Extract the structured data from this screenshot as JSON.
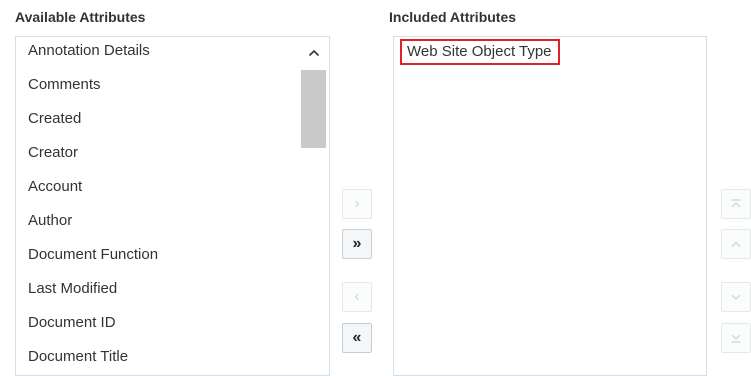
{
  "available": {
    "heading": "Available Attributes",
    "items": [
      "Annotation Details",
      "Comments",
      "Created",
      "Creator",
      "Account",
      "Author",
      "Document Function",
      "Last Modified",
      "Document ID",
      "Document Title"
    ]
  },
  "included": {
    "heading": "Included Attributes",
    "items": [
      "Web Site Object Type"
    ]
  },
  "shuttle": {
    "move_right": "›",
    "move_all_right": "»",
    "move_left": "‹",
    "move_all_left": "«"
  },
  "reorder": {
    "top_icon": "move-to-top-icon",
    "up_icon": "move-up-icon",
    "down_icon": "move-down-icon",
    "bottom_icon": "move-to-bottom-icon"
  },
  "colors": {
    "highlight_border": "#e0202a",
    "list_border": "#d6dfe6",
    "scroll_thumb": "#c9c9c9"
  }
}
